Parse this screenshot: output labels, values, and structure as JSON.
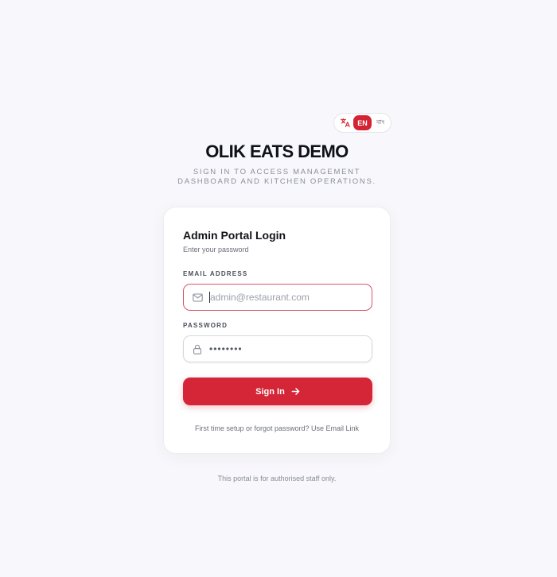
{
  "language": {
    "icon": "translate-icon",
    "options": [
      "EN",
      "বাং"
    ],
    "active": "EN"
  },
  "brand": {
    "title": "OLIK EATS DEMO",
    "subtitle": "SIGN IN TO ACCESS MANAGEMENT DASHBOARD AND KITCHEN OPERATIONS."
  },
  "card": {
    "title": "Admin Portal Login",
    "description": "Enter your password"
  },
  "email": {
    "label": "EMAIL ADDRESS",
    "placeholder": "admin@restaurant.com",
    "value": "",
    "icon": "mail-icon"
  },
  "password": {
    "label": "PASSWORD",
    "value": "••••••••",
    "icon": "lock-icon"
  },
  "signin": {
    "label": "Sign In",
    "icon": "arrow-right-icon"
  },
  "help": {
    "text": "First time setup or forgot password?",
    "link": "Use Email Link"
  },
  "footer": {
    "note": "This portal is for authorised staff only."
  },
  "colors": {
    "accent": "#d42636",
    "background": "#f8f8fc",
    "focus_border": "#d8546a"
  }
}
